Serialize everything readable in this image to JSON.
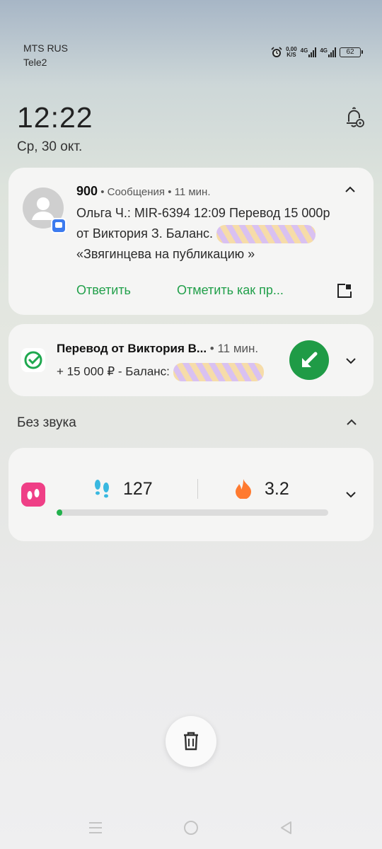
{
  "status_bar": {
    "carrier1": "MTS RUS",
    "carrier2": "Tele2",
    "net_speed_value": "0,00",
    "net_speed_unit": "K/S",
    "sim1_type": "4G",
    "sim2_type": "4G",
    "battery": "62",
    "icons": [
      "alarm-icon",
      "signal-icon",
      "battery-icon"
    ]
  },
  "lockscreen": {
    "time": "12:22",
    "date": "Ср, 30 окт."
  },
  "notifications": [
    {
      "sender": "900",
      "meta": " • Сообщения • 11 мин.",
      "line1": "Ольга Ч.: MIR-6394 12:09 Перевод 15 000р",
      "line2": "от Виктория З. Баланс. ",
      "line3": "«Звягинцева на публикацию »",
      "action_reply": "Ответить",
      "action_mark": "Отметить как пр..."
    },
    {
      "title": "Перевод от Виктория В...",
      "meta": " • 11 мин.",
      "body": "+ 15 000 ₽ - Баланс: "
    }
  ],
  "silent_section": {
    "label": "Без звука",
    "steps": "127",
    "kcal": "3.2",
    "progress_fraction": 0.02
  },
  "colors": {
    "accent_green": "#22a04b",
    "fab_green": "#1f9b46",
    "badge_blue": "#3c7bef"
  }
}
